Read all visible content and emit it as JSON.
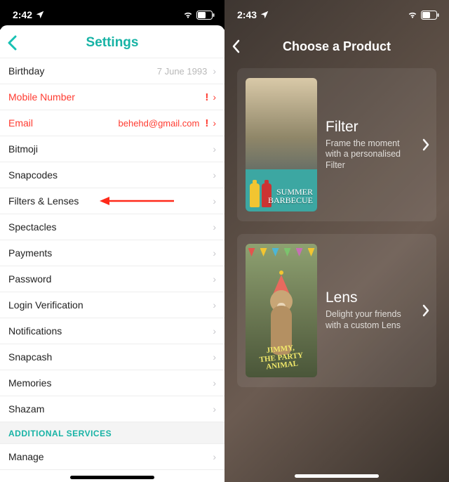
{
  "left": {
    "status": {
      "time": "2:42"
    },
    "header": {
      "title": "Settings"
    },
    "rows": [
      {
        "label": "Birthday",
        "value": "7 June 1993",
        "alert": false
      },
      {
        "label": "Mobile Number",
        "value": "",
        "alert": true
      },
      {
        "label": "Email",
        "value": "behehd@gmail.com",
        "alert": true
      },
      {
        "label": "Bitmoji",
        "value": "",
        "alert": false
      },
      {
        "label": "Snapcodes",
        "value": "",
        "alert": false
      },
      {
        "label": "Filters & Lenses",
        "value": "",
        "alert": false,
        "callout": true
      },
      {
        "label": "Spectacles",
        "value": "",
        "alert": false
      },
      {
        "label": "Payments",
        "value": "",
        "alert": false
      },
      {
        "label": "Password",
        "value": "",
        "alert": false
      },
      {
        "label": "Login Verification",
        "value": "",
        "alert": false
      },
      {
        "label": "Notifications",
        "value": "",
        "alert": false
      },
      {
        "label": "Snapcash",
        "value": "",
        "alert": false
      },
      {
        "label": "Memories",
        "value": "",
        "alert": false
      },
      {
        "label": "Shazam",
        "value": "",
        "alert": false
      }
    ],
    "section_header": "ADDITIONAL SERVICES",
    "rows2": [
      {
        "label": "Manage",
        "value": ""
      }
    ]
  },
  "right": {
    "status": {
      "time": "2:43"
    },
    "header": {
      "title": "Choose a Product"
    },
    "cards": {
      "filter": {
        "title": "Filter",
        "subtitle": "Frame the moment with a personalised Filter",
        "thumb_caption_line1": "SUMMER",
        "thumb_caption_line2": "BARBECUE"
      },
      "lens": {
        "title": "Lens",
        "subtitle": "Delight your friends with a custom Lens",
        "thumb_caption_line1": "JIMMY,",
        "thumb_caption_line2": "THE PARTY",
        "thumb_caption_line3": "ANIMAL"
      }
    }
  }
}
